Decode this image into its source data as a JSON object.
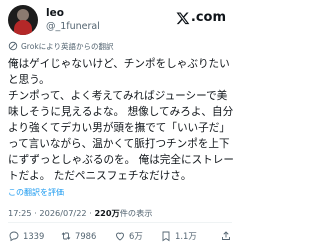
{
  "author": {
    "display_name": "leo",
    "handle": "@_1funeral"
  },
  "brand": {
    "com": ".com"
  },
  "translation_note": "Grokにより英語からの翻訳",
  "tweet": {
    "text": "俺はゲイじゃないけど、チンポをしゃぶりたいと思う。\nチンポって、よく考えてみればジューシーで美味しそうに見えるよな。 想像してみろよ、自分より強くてデカい男が頭を撫でて「いい子だ」って言いながら、温かくて脈打つチンポを上下にずずっとしゃぶるのを。 俺は完全にストレートだよ。 ただペニスフェチなだけさ。"
  },
  "rate_translation": "この翻訳を評価",
  "meta": {
    "time": "17:25",
    "sep1": " · ",
    "date": "2026/07/22",
    "sep2": " · ",
    "views_count": "220万",
    "views_label": "件の表示"
  },
  "actions": {
    "replies": "1339",
    "reposts": "7986",
    "likes": "6万",
    "bookmarks": "1.1万"
  },
  "colors": {
    "link": "#1d9bf0",
    "secondary_text": "#536471",
    "primary_text": "#0f1419"
  }
}
